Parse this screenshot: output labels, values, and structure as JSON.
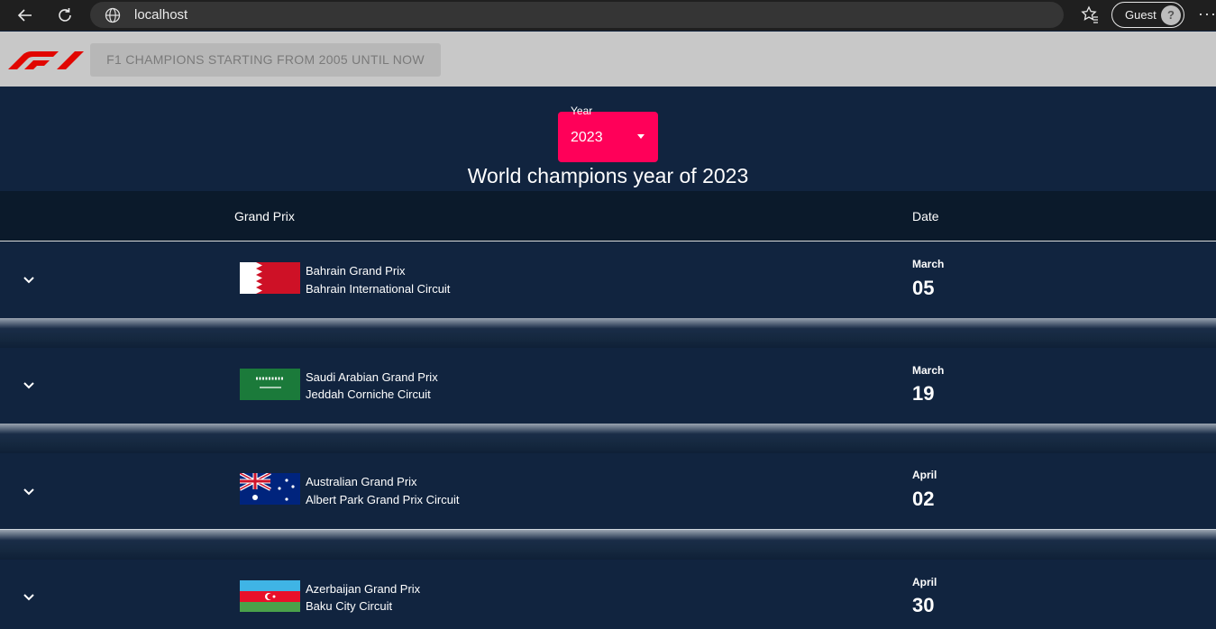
{
  "browser": {
    "url": "localhost",
    "guest_label": "Guest",
    "more_label": "···"
  },
  "header": {
    "button_label": "F1 CHAMPIONS STARTING FROM 2005 UNTIL NOW"
  },
  "year_select": {
    "label": "Year",
    "value": "2023"
  },
  "title": "World champions year of 2023",
  "table": {
    "col_grand_prix": "Grand Prix",
    "col_date": "Date",
    "races": [
      {
        "name": "Bahrain Grand Prix",
        "circuit": "Bahrain International Circuit",
        "month": "March",
        "day": "05",
        "flag": "bahrain-flag"
      },
      {
        "name": "Saudi Arabian Grand Prix",
        "circuit": "Jeddah Corniche Circuit",
        "month": "March",
        "day": "19",
        "flag": "saudi-arabia-flag"
      },
      {
        "name": "Australian Grand Prix",
        "circuit": "Albert Park Grand Prix Circuit",
        "month": "April",
        "day": "02",
        "flag": "australia-flag"
      },
      {
        "name": "Azerbaijan Grand Prix",
        "circuit": "Baku City Circuit",
        "month": "April",
        "day": "30",
        "flag": "azerbaijan-flag"
      }
    ]
  },
  "colors": {
    "accent": "#ff0059",
    "background": "#11243f",
    "header_bg": "#c8c8c8",
    "table_head_bg": "#0b1a2b"
  }
}
